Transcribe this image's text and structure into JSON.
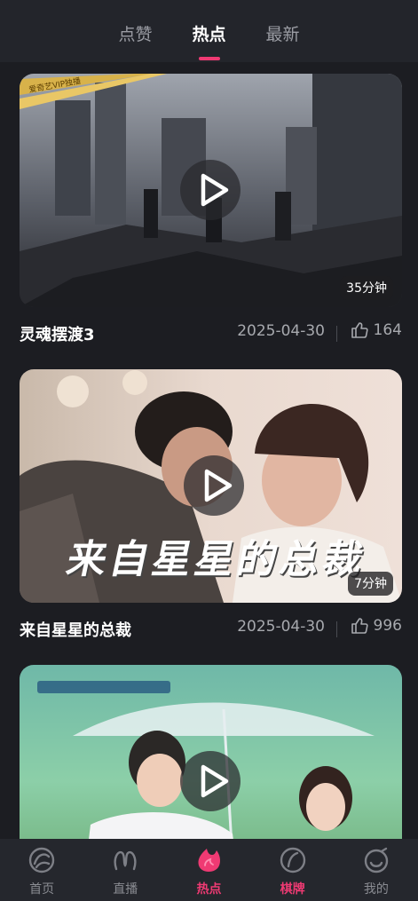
{
  "top_tabs": [
    {
      "label": "点赞",
      "active": false
    },
    {
      "label": "热点",
      "active": true
    },
    {
      "label": "最新",
      "active": false
    }
  ],
  "videos": [
    {
      "title": "灵魂摆渡3",
      "date": "2025-04-30",
      "likes": "164",
      "duration": "35分钟",
      "banner": "爱奇艺VIP独播"
    },
    {
      "title": "来自星星的总裁",
      "date": "2025-04-30",
      "likes": "996",
      "duration": "7分钟",
      "poster_text": "来自星星的总裁"
    },
    {
      "title": "",
      "date": "",
      "likes": "",
      "duration": ""
    }
  ],
  "bottom_nav": [
    {
      "label": "首页",
      "icon": "home-icon",
      "active": false
    },
    {
      "label": "直播",
      "icon": "live-icon",
      "active": false
    },
    {
      "label": "热点",
      "icon": "hot-icon",
      "active": true
    },
    {
      "label": "棋牌",
      "icon": "cards-icon",
      "active": false
    },
    {
      "label": "我的",
      "icon": "profile-icon",
      "active": false
    }
  ],
  "colors": {
    "accent": "#ef3a73",
    "background": "#1c1d22",
    "bar": "#23252b"
  }
}
